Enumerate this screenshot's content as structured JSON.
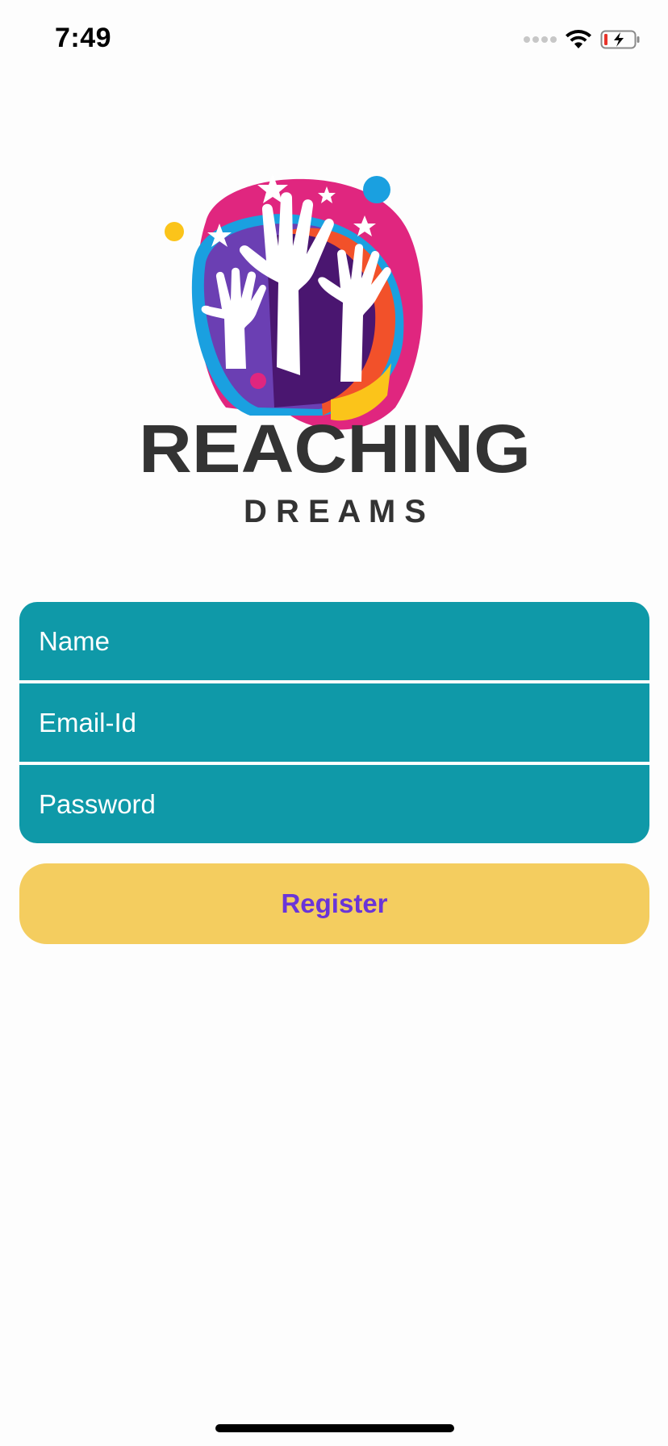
{
  "status_bar": {
    "time": "7:49",
    "icons": [
      "signal-dots-icon",
      "wifi-icon",
      "battery-charging-icon"
    ]
  },
  "logo": {
    "title": "REACHING",
    "subtitle": "D R E A M S",
    "colors": {
      "pink": "#e0267f",
      "purple": "#6b3fb3",
      "dark_purple": "#4a1670",
      "blue": "#1aa0e0",
      "orange": "#f2512a",
      "yellow": "#fbc41a",
      "text": "#333333"
    }
  },
  "form": {
    "name_placeholder": "Name",
    "email_placeholder": "Email-Id",
    "password_placeholder": "Password"
  },
  "register": {
    "label": "Register"
  },
  "colors": {
    "field_bg": "#0f99a8",
    "button_bg": "#f4cd5f",
    "button_text": "#6a35d8",
    "page_bg": "#fdfdfd"
  }
}
